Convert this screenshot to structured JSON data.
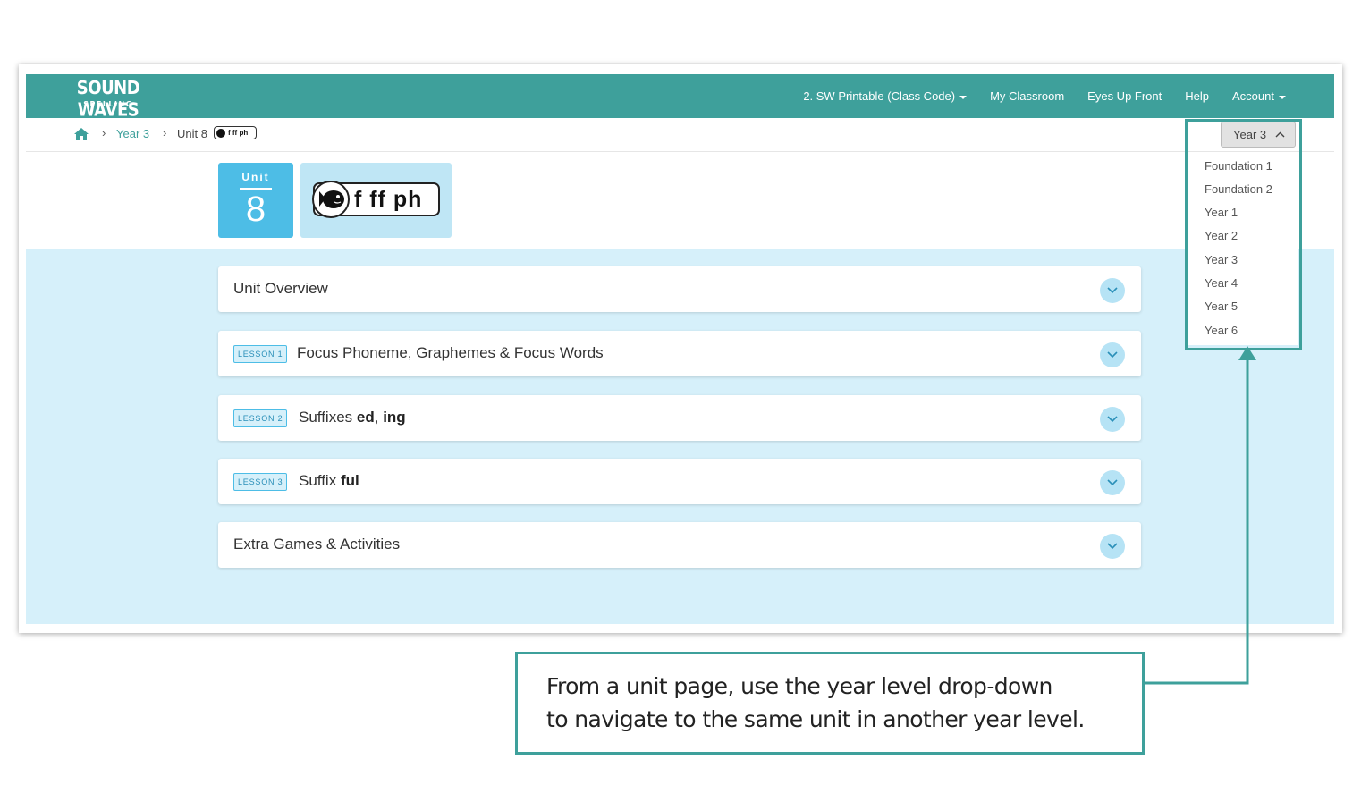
{
  "brand": {
    "name": "SOUND WAVES",
    "sub": "SPELLING"
  },
  "nav": {
    "items": [
      {
        "label": "2. SW Printable (Class Code)",
        "dropdown": true
      },
      {
        "label": "My Classroom",
        "dropdown": false
      },
      {
        "label": "Eyes Up Front",
        "dropdown": false
      },
      {
        "label": "Help",
        "dropdown": false
      },
      {
        "label": "Account",
        "dropdown": true
      }
    ]
  },
  "breadcrumb": {
    "year": "Year 3",
    "unit": "Unit 8",
    "chip": "f ff ph"
  },
  "unit": {
    "label": "Unit",
    "number": "8",
    "phonemes": "f ff ph"
  },
  "accordion": [
    {
      "title": "Unit Overview"
    },
    {
      "badge": "LESSON 1",
      "title": "Focus Phoneme, Graphemes & Focus Words"
    },
    {
      "badge": "LESSON 2",
      "title_prefix": "Suffixes ",
      "title_bold_1": "ed",
      "title_sep": ", ",
      "title_bold_2": "ing"
    },
    {
      "badge": "LESSON 3",
      "title_prefix": "Suffix ",
      "title_bold_1": "ful"
    },
    {
      "title": "Extra Games & Activities"
    }
  ],
  "year_select": {
    "selected": "Year 3",
    "options": [
      "Foundation 1",
      "Foundation 2",
      "Year 1",
      "Year 2",
      "Year 3",
      "Year 4",
      "Year 5",
      "Year 6"
    ]
  },
  "callout": {
    "line1": "From a unit page, use the year level drop-down",
    "line2": "to navigate to the same unit in another year level."
  },
  "colors": {
    "teal": "#3ea09b",
    "light_blue": "#d6f0fa",
    "unit_blue": "#4dbde6"
  }
}
